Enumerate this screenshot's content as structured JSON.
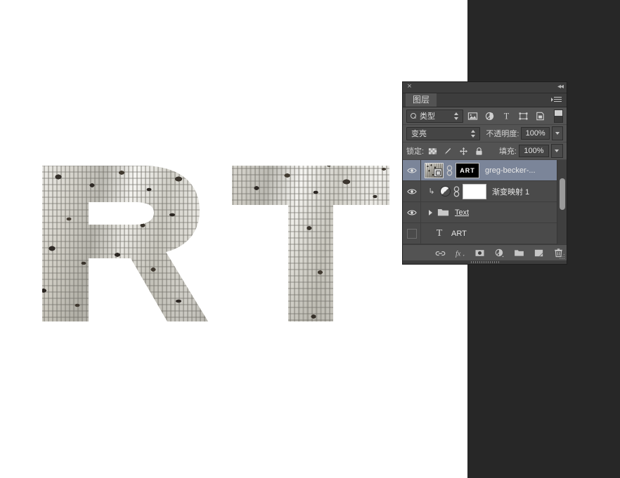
{
  "app": {
    "canvas_background": "#ffffff",
    "backdrop_color": "#272727",
    "accent_selected_row": "#7b8599"
  },
  "artwork": {
    "name": "double-exposure-typography",
    "letters": [
      "R",
      "T"
    ],
    "description": "Double exposure of city buildings and tree foliage clipped inside the letters R and T"
  },
  "panel": {
    "title": "图层",
    "close_label": "×",
    "collapse_label": "«",
    "menu_label": "menu",
    "filter": {
      "kind_label": "类型",
      "icons": [
        {
          "name": "filter-pixel-layers-icon",
          "glyph": "image"
        },
        {
          "name": "filter-adjustment-layers-icon",
          "glyph": "adjustment"
        },
        {
          "name": "filter-type-layers-icon",
          "glyph": "T"
        },
        {
          "name": "filter-shape-layers-icon",
          "glyph": "shape"
        },
        {
          "name": "filter-smart-object-layers-icon",
          "glyph": "smart"
        }
      ],
      "toggle_name": "filter-enable-toggle"
    },
    "blend": {
      "mode": "变亮",
      "opacity_label": "不透明度:",
      "opacity_value": "100%"
    },
    "lock": {
      "label": "锁定:",
      "icons": [
        {
          "name": "lock-transparent-pixels-icon"
        },
        {
          "name": "lock-image-pixels-icon"
        },
        {
          "name": "lock-position-icon"
        },
        {
          "name": "lock-all-icon"
        }
      ],
      "fill_label": "填充:",
      "fill_value": "100%"
    },
    "layers": [
      {
        "id": "layer-greg-becker",
        "visible": true,
        "selected": true,
        "name": "greg-becker-...",
        "has_thumbnail": true,
        "smart_object": true,
        "linked": true,
        "mask_label": "ART",
        "mask_kind": "black",
        "kind": "smart-object"
      },
      {
        "id": "layer-gradient-map-1",
        "visible": true,
        "selected": false,
        "name": "渐变映射 1",
        "clipped": true,
        "adjustment": true,
        "linked": true,
        "mask_label": "",
        "mask_kind": "white",
        "kind": "adjustment"
      },
      {
        "id": "layer-group-text",
        "visible": true,
        "selected": false,
        "name": "Text",
        "name_underlined": true,
        "kind": "group",
        "expanded": false
      },
      {
        "id": "layer-art-type",
        "visible": false,
        "selected": false,
        "name": "ART",
        "kind": "type"
      }
    ],
    "footer_icons": [
      {
        "name": "link-layers-icon"
      },
      {
        "name": "layer-style-fx-icon",
        "label": "fx"
      },
      {
        "name": "add-layer-mask-icon"
      },
      {
        "name": "new-adjustment-layer-icon"
      },
      {
        "name": "new-group-icon"
      },
      {
        "name": "new-layer-icon"
      },
      {
        "name": "delete-layer-icon"
      }
    ]
  }
}
